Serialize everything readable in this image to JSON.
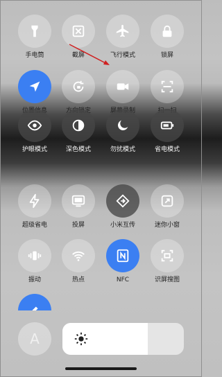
{
  "tiles": [
    {
      "label": "手电筒",
      "icon": "flashlight-icon"
    },
    {
      "label": "截屏",
      "icon": "screenshot-icon"
    },
    {
      "label": "飞行模式",
      "icon": "airplane-icon"
    },
    {
      "label": "锁屏",
      "icon": "lock-icon"
    },
    {
      "label": "位置信息",
      "icon": "location-icon",
      "active": true
    },
    {
      "label": "方向锁定",
      "icon": "rotation-lock-icon"
    },
    {
      "label": "屏幕录制",
      "icon": "video-camera-icon"
    },
    {
      "label": "扫一扫",
      "icon": "scan-icon"
    },
    {
      "label": "护眼模式",
      "icon": "eye-icon"
    },
    {
      "label": "深色模式",
      "icon": "dark-mode-icon"
    },
    {
      "label": "勿扰模式",
      "icon": "moon-icon"
    },
    {
      "label": "省电模式",
      "icon": "battery-icon"
    },
    {
      "label": "超级省电",
      "icon": "lightning-icon"
    },
    {
      "label": "投屏",
      "icon": "cast-screen-icon"
    },
    {
      "label": "小米互传",
      "icon": "xiaomi-share-icon"
    },
    {
      "label": "迷你小窗",
      "icon": "mini-window-icon"
    },
    {
      "label": "振动",
      "icon": "vibrate-icon"
    },
    {
      "label": "热点",
      "icon": "hotspot-icon"
    },
    {
      "label": "NFC",
      "icon": "nfc-icon",
      "active": true
    },
    {
      "label": "识屏搜图",
      "icon": "screen-search-icon"
    }
  ],
  "font_button": {
    "label": "A"
  },
  "brightness": {
    "level": 0.7
  },
  "colors": {
    "accent": "#3b7ff2",
    "annotation_arrow": "#d02020"
  }
}
